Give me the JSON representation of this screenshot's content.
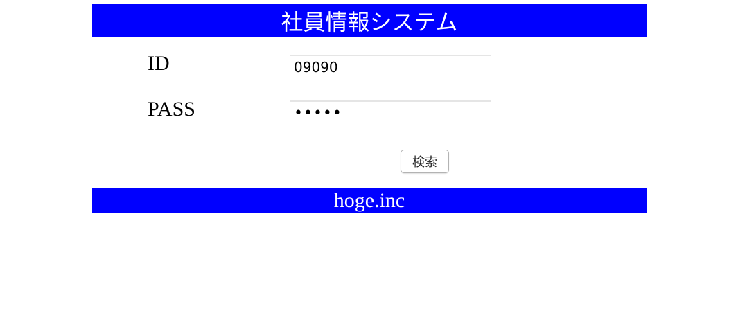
{
  "header": {
    "title": "社員情報システム"
  },
  "form": {
    "id_label": "ID",
    "id_value": "09090",
    "pass_label": "PASS",
    "pass_value": "•••••",
    "search_button_label": "検索"
  },
  "footer": {
    "text": "hoge.inc"
  },
  "colors": {
    "bar_background": "#0000ff",
    "bar_text": "#ffffff"
  }
}
